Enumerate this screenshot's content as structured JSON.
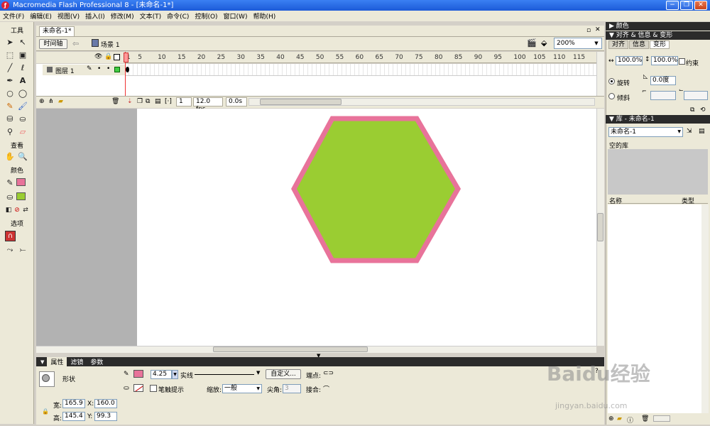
{
  "window": {
    "title": "Macromedia Flash Professional 8 - [未命名-1*]",
    "controls": [
      "−",
      "❐",
      "✕"
    ]
  },
  "menu": [
    "文件(F)",
    "编辑(E)",
    "视图(V)",
    "插入(I)",
    "修改(M)",
    "文本(T)",
    "命令(C)",
    "控制(O)",
    "窗口(W)",
    "帮助(H)"
  ],
  "toolbar": {
    "sections": {
      "tools": "工具",
      "view": "查看",
      "colors": "颜色",
      "options": "选项"
    },
    "tools": [
      "selection-icon",
      "subselection-icon",
      "free-transform-icon",
      "fill-transform-icon",
      "line-icon",
      "lasso-icon",
      "pen-icon",
      "text-icon",
      "oval-icon",
      "rectangle-icon",
      "pencil-icon",
      "brush-icon",
      "ink-bottle-icon",
      "paint-bucket-icon",
      "eyedropper-icon",
      "eraser-icon",
      "hand-icon",
      "zoom-icon"
    ]
  },
  "document": {
    "tab": "未命名-1*",
    "timeline_button": "时间轴",
    "scene": "场景 1",
    "zoom": "200%",
    "layer_name": "图层 1",
    "frame_numbers": [
      "1",
      "5",
      "10",
      "15",
      "20",
      "25",
      "30",
      "35",
      "40",
      "45",
      "50",
      "55",
      "60",
      "65",
      "70",
      "75",
      "80",
      "85",
      "90",
      "95",
      "100",
      "105",
      "110",
      "115"
    ],
    "current_frame": "1",
    "fps": "12.0 fps",
    "time": "0.0s"
  },
  "colors": {
    "hexagon_fill": "#9ACD32",
    "hexagon_stroke": "#E8739A",
    "stroke_swatch": "#E8739A",
    "fill_swatch": "#9ACD32",
    "panel_bg": "#ECE9D8",
    "pasteboard": "#B2B2B2"
  },
  "properties": {
    "tabs": [
      "属性",
      "滤镜",
      "参数"
    ],
    "shape_label": "形状",
    "stroke_width": "4.25",
    "stroke_style": "实线",
    "custom_button": "自定义...",
    "cap_label": "端点:",
    "stroke_hint": "笔触提示",
    "scale_label": "缩放:",
    "scale_value": "一般",
    "miter_label": "尖角:",
    "miter_value": "3",
    "join_label": "接合:",
    "width_label": "宽:",
    "width_value": "165.9",
    "height_label": "高:",
    "height_value": "145.4",
    "x_label": "X:",
    "x_value": "160.0",
    "y_label": "Y:",
    "y_value": "99.3"
  },
  "right_panels": {
    "color_header": "颜色",
    "transform_header": "对齐 & 信息 & 变形",
    "transform_tabs": [
      "对齐",
      "信息",
      "变形"
    ],
    "scale_w": "100.0%",
    "scale_h": "100.0%",
    "constrain": "约束",
    "rotate_label": "旋转",
    "rotate_value": "0.0度",
    "skew_label": "倾斜",
    "library_header": "库 - 未命名-1",
    "library_select": "未命名-1",
    "library_empty": "空的库",
    "col_name": "名称",
    "col_type": "类型"
  },
  "watermark": {
    "main": "Baidu经验",
    "sub": "jingyan.baidu.com"
  }
}
